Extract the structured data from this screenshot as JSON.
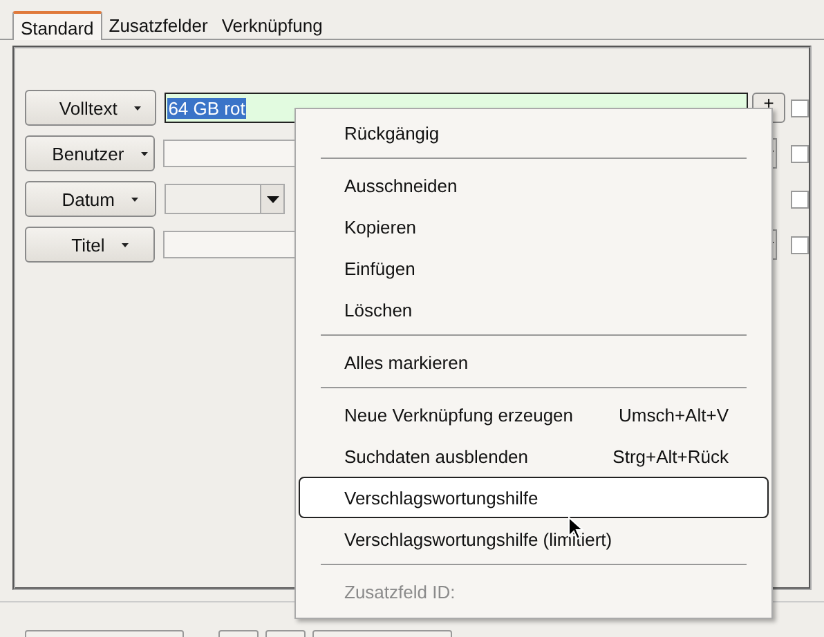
{
  "tabs": [
    {
      "label": "Standard",
      "selected": true
    },
    {
      "label": "Zusatzfelder",
      "selected": false
    },
    {
      "label": "Verknüpfung",
      "selected": false
    }
  ],
  "fields": [
    {
      "label": "Volltext",
      "kind": "text",
      "value": "64 GB rot",
      "value_selected": true,
      "plus": "+",
      "checked": false
    },
    {
      "label": "Benutzer",
      "kind": "combo",
      "checked": false
    },
    {
      "label": "Datum",
      "kind": "date",
      "checked": false
    },
    {
      "label": "Titel",
      "kind": "combo",
      "checked": false
    }
  ],
  "context_menu": [
    {
      "kind": "item",
      "label": "Rückgängig",
      "disabled": false,
      "selected": false
    },
    {
      "kind": "separator"
    },
    {
      "kind": "item",
      "label": "Ausschneiden",
      "disabled": false,
      "selected": false
    },
    {
      "kind": "item",
      "label": "Kopieren",
      "disabled": false,
      "selected": false
    },
    {
      "kind": "item",
      "label": "Einfügen",
      "disabled": false,
      "selected": false
    },
    {
      "kind": "item",
      "label": "Löschen",
      "disabled": false,
      "selected": false
    },
    {
      "kind": "separator"
    },
    {
      "kind": "item",
      "label": "Alles markieren",
      "disabled": false,
      "selected": false
    },
    {
      "kind": "separator"
    },
    {
      "kind": "item",
      "label": "Neue Verknüpfung erzeugen",
      "shortcut": "Umsch+Alt+V",
      "disabled": false,
      "selected": false
    },
    {
      "kind": "item",
      "label": "Suchdaten ausblenden",
      "shortcut": "Strg+Alt+Rück",
      "disabled": false,
      "selected": false
    },
    {
      "kind": "item",
      "label": "Verschlagswortungshilfe",
      "disabled": false,
      "selected": true
    },
    {
      "kind": "item",
      "label": "Verschlagswortungshilfe (limitiert)",
      "disabled": false,
      "selected": false
    },
    {
      "kind": "separator"
    },
    {
      "kind": "item",
      "label": "Zusatzfeld ID:",
      "disabled": true,
      "selected": false
    }
  ]
}
